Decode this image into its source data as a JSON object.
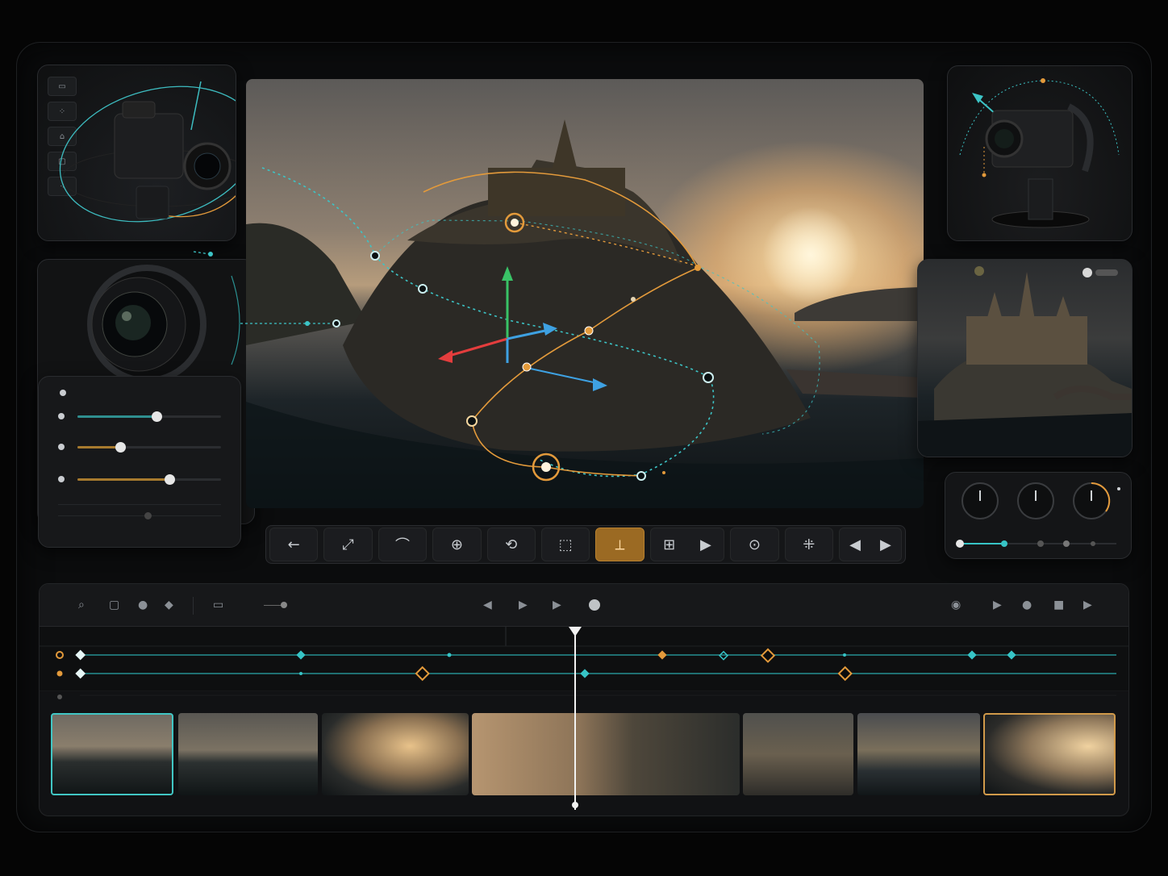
{
  "colors": {
    "accent_teal": "#37c4c6",
    "accent_orange": "#e39a3b",
    "active_tool": "#9b6a23",
    "panel_bg": "#141517",
    "frame_bg": "#0b0c0d"
  },
  "left_tools": [
    "frame-icon",
    "nodes-icon",
    "home-icon",
    "box-icon",
    "scatter-icon"
  ],
  "sliders": [
    {
      "name": "slider-teal",
      "value": 0.55,
      "color": "#2f8f8f"
    },
    {
      "name": "slider-orange-1",
      "value": 0.3,
      "color": "#a77a2e"
    },
    {
      "name": "slider-orange-2",
      "value": 0.64,
      "color": "#a77a2e"
    }
  ],
  "toolbar": {
    "tools": [
      {
        "name": "back-arrow-icon",
        "glyph": "←"
      },
      {
        "name": "scale-icon",
        "glyph": "⤢"
      },
      {
        "name": "path-icon",
        "glyph": "⌒"
      },
      {
        "name": "target-icon",
        "glyph": "⊕"
      },
      {
        "name": "rotate-icon",
        "glyph": "⟲"
      },
      {
        "name": "frame-select-icon",
        "glyph": "⬚"
      },
      {
        "name": "axis-gizmo-icon",
        "glyph": "⟂"
      },
      {
        "name": "grid-icon",
        "glyph": "⊞"
      },
      {
        "name": "play-icon",
        "glyph": "▶"
      },
      {
        "name": "focus-icon",
        "glyph": "⊙"
      },
      {
        "name": "snap-icon",
        "glyph": "⁜"
      },
      {
        "name": "prev-next-icon",
        "glyph": "◀ ▶"
      }
    ],
    "active_index": 6
  },
  "timeline": {
    "playhead_fraction": 0.49,
    "thumbnail_count": 8
  },
  "dials": [
    {
      "name": "dial-1",
      "value": 0.5
    },
    {
      "name": "dial-2",
      "value": 0.5
    },
    {
      "name": "dial-3",
      "value": 0.6
    }
  ]
}
